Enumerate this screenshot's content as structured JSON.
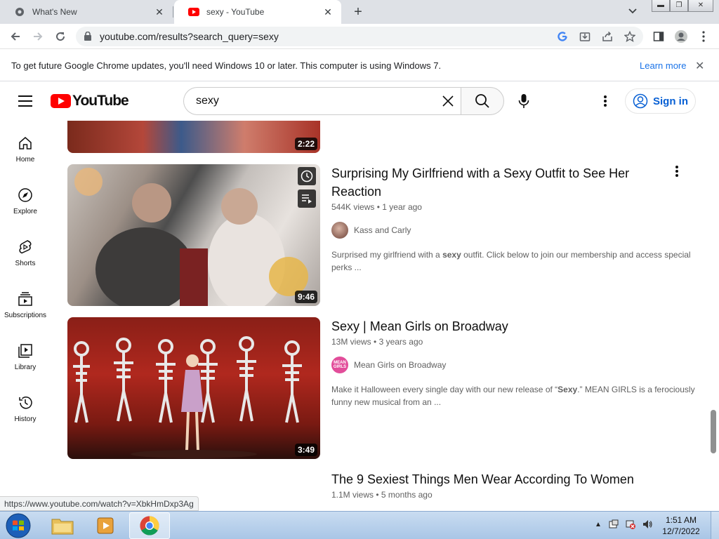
{
  "browser": {
    "tabs": [
      {
        "title": "What's New",
        "active": false
      },
      {
        "title": "sexy - YouTube",
        "active": true
      }
    ],
    "new_tab": "+",
    "url": "youtube.com/results?search_query=sexy",
    "infobar": {
      "message": "To get future Google Chrome updates, you'll need Windows 10 or later. This computer is using Windows 7.",
      "link": "Learn more"
    },
    "status_url": "https://www.youtube.com/watch?v=XbkHmDxp3Ag"
  },
  "youtube": {
    "logo_text": "YouTube",
    "search_value": "sexy",
    "signin_label": "Sign in",
    "guide": [
      {
        "label": "Home",
        "icon": "home-icon"
      },
      {
        "label": "Explore",
        "icon": "explore-icon"
      },
      {
        "label": "Shorts",
        "icon": "shorts-icon"
      },
      {
        "label": "Subscriptions",
        "icon": "subscriptions-icon"
      },
      {
        "label": "Library",
        "icon": "library-icon"
      },
      {
        "label": "History",
        "icon": "history-icon"
      }
    ],
    "results": [
      {
        "duration": "2:22"
      },
      {
        "title": "Surprising My Girlfriend with a Sexy Outfit to See Her Reaction",
        "views": "544K views",
        "age": "1 year ago",
        "channel": "Kass and Carly",
        "description_pre": "Surprised my girlfriend with a ",
        "description_bold": "sexy",
        "description_post": " outfit. Click below to join our membership and access special perks ...",
        "duration": "9:46"
      },
      {
        "title": "Sexy | Mean Girls on Broadway",
        "views": "13M views",
        "age": "3 years ago",
        "channel": "Mean Girls on Broadway",
        "channel_avatar_text": "MEAN GIRLS",
        "description_pre": "Make it Halloween every single day with our new release of “",
        "description_bold": "Sexy",
        "description_post": ".” MEAN GIRLS is a ferociously funny new musical from an ...",
        "duration": "3:49"
      },
      {
        "title": "The 9 Sexiest Things Men Wear According To Women",
        "views": "1.1M views",
        "age": "5 months ago"
      }
    ],
    "meta_separator": "•"
  },
  "taskbar": {
    "time": "1:51 AM",
    "date": "12/7/2022"
  }
}
